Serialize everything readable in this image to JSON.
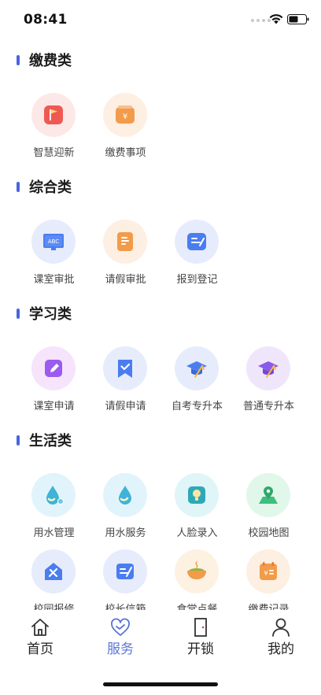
{
  "status_bar": {
    "time": "08:41"
  },
  "sections": [
    {
      "title": "缴费类",
      "items": [
        {
          "label": "智慧迎新",
          "icon": "flag-icon"
        },
        {
          "label": "缴费事项",
          "icon": "yuan-wallet-icon"
        }
      ]
    },
    {
      "title": "综合类",
      "items": [
        {
          "label": "课室审批",
          "icon": "abc-board-icon"
        },
        {
          "label": "请假审批",
          "icon": "leave-document-icon"
        },
        {
          "label": "报到登记",
          "icon": "checkin-card-icon"
        }
      ]
    },
    {
      "title": "学习类",
      "items": [
        {
          "label": "课室申请",
          "icon": "pencil-icon"
        },
        {
          "label": "请假申请",
          "icon": "bookmark-check-icon"
        },
        {
          "label": "自考专升本",
          "icon": "graduation-cap-icon"
        },
        {
          "label": "普通专升本",
          "icon": "graduation-cap-purple-icon"
        }
      ]
    },
    {
      "title": "生活类",
      "items": [
        {
          "label": "用水管理",
          "icon": "water-drop-gear-icon"
        },
        {
          "label": "用水服务",
          "icon": "water-drop-icon"
        },
        {
          "label": "人脸录入",
          "icon": "face-scan-icon"
        },
        {
          "label": "校园地图",
          "icon": "map-pin-icon"
        },
        {
          "label": "校园报修",
          "icon": "repair-house-icon"
        },
        {
          "label": "校长信箱",
          "icon": "mailbox-pen-icon"
        },
        {
          "label": "食堂点餐",
          "icon": "food-bowl-icon"
        },
        {
          "label": "缴费记录",
          "icon": "payment-record-icon"
        }
      ]
    }
  ],
  "tabs": [
    {
      "label": "首页",
      "icon": "home-icon",
      "active": false
    },
    {
      "label": "服务",
      "icon": "heart-service-icon",
      "active": true
    },
    {
      "label": "开锁",
      "icon": "door-icon",
      "active": false
    },
    {
      "label": "我的",
      "icon": "user-icon",
      "active": false
    }
  ],
  "colors": {
    "accent": "#4a64e0",
    "active_tab": "#5a76d4",
    "red": "#ee5a52",
    "orange": "#f29b4a",
    "blue": "#4a7df0",
    "purple": "#9b5af0",
    "cyan": "#3fb3d8",
    "green": "#3cbf7c"
  }
}
